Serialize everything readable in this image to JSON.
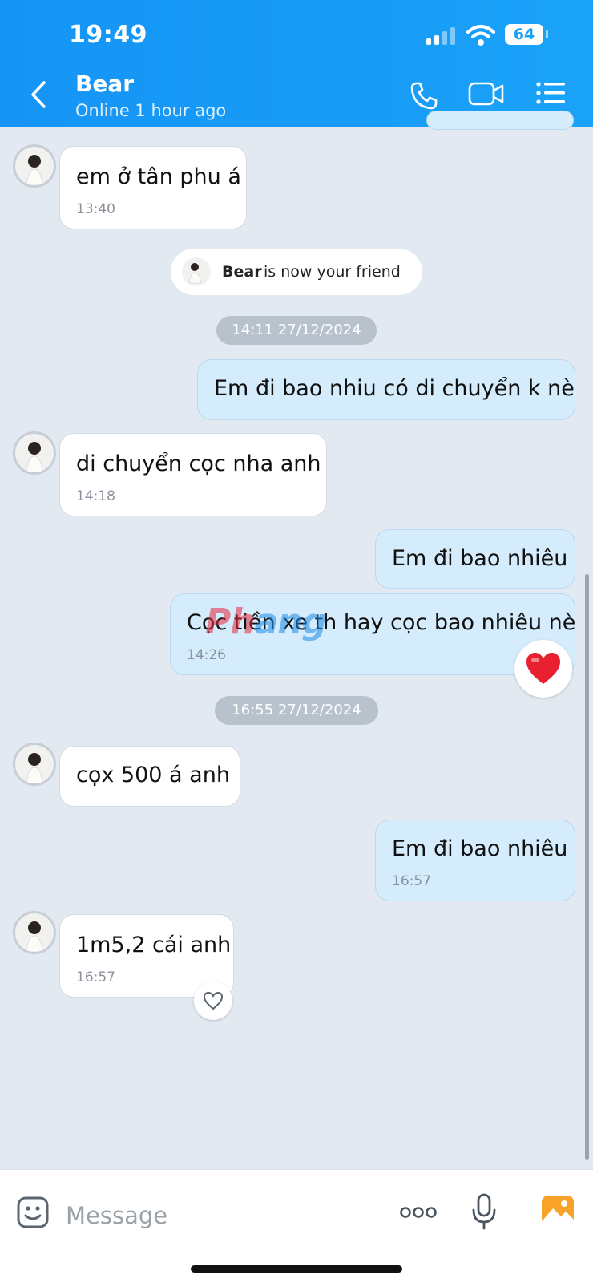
{
  "status_bar": {
    "time": "19:49",
    "battery": "64"
  },
  "header": {
    "contact_name": "Bear",
    "contact_status": "Online 1 hour ago"
  },
  "messages": [
    {
      "from": "contact",
      "text": "em ở tân phu á",
      "time": "13:40"
    },
    {
      "from": "system",
      "name": "Bear",
      "text": "is now your friend"
    },
    {
      "from": "date",
      "text": "14:11 27/12/2024"
    },
    {
      "from": "me",
      "text": "Em đi bao nhiu có di chuyển k nè"
    },
    {
      "from": "contact",
      "text": "di chuyển cọc nha anh",
      "time": "14:18"
    },
    {
      "from": "me",
      "text": "Em đi bao nhiêu"
    },
    {
      "from": "me",
      "text": "Cọc tiền xe th hay cọc bao nhiêu nè",
      "time": "14:26"
    },
    {
      "from": "date",
      "text": "16:55 27/12/2024"
    },
    {
      "from": "contact",
      "text": "cọx 500 á anh"
    },
    {
      "from": "me",
      "text": "Em đi bao nhiêu",
      "time": "16:57"
    },
    {
      "from": "contact",
      "text": "1m5,2 cái anh",
      "time": "16:57"
    }
  ],
  "watermark": {
    "part1": "Ph",
    "part2": "ang"
  },
  "composer": {
    "placeholder": "Message"
  },
  "icons": {
    "back": "chevron-left-icon",
    "call": "phone-icon",
    "video": "video-icon",
    "menu": "list-icon",
    "emoji": "sticker-icon",
    "more": "more-dots-icon",
    "mic": "microphone-icon",
    "gallery": "image-icon",
    "reaction": "heart-icon"
  },
  "colors": {
    "header": "#1a9ef7",
    "bubble_out": "#d4ecfb",
    "bubble_in": "#ffffff",
    "background": "#e2e9f1",
    "heart": "#e8202f"
  }
}
